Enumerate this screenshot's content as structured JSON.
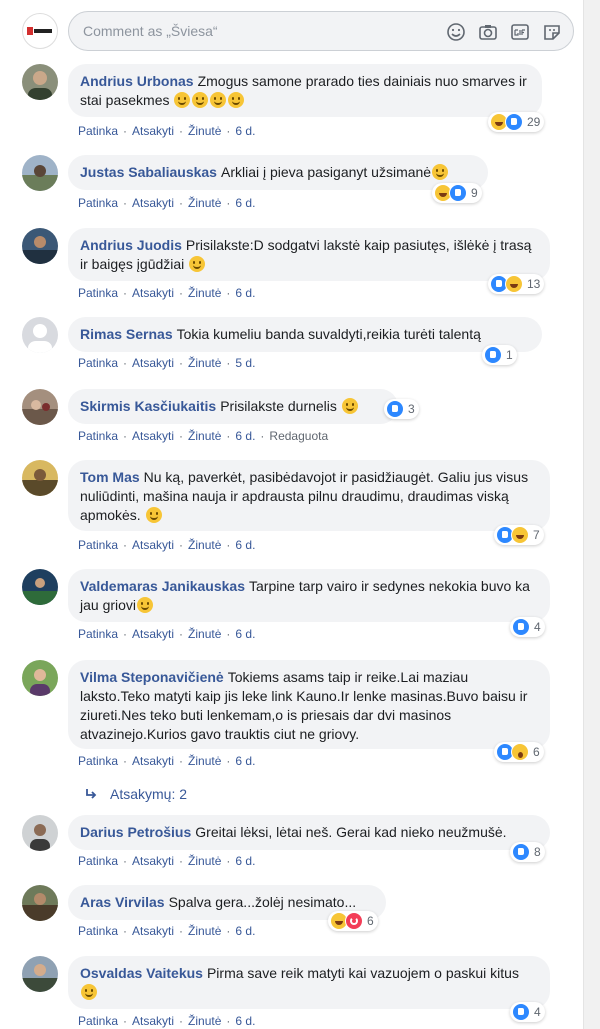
{
  "composer": {
    "placeholder": "Comment as „Šviesa“"
  },
  "comments": [
    {
      "author": "Andrius Urbonas",
      "text": "Zmogus samone prarado ties dainiais nuo smarves ir stai pasekmes",
      "emoji_count": 4,
      "reactions": [
        "haha",
        "like"
      ],
      "count": "29",
      "like": "Patinka",
      "reply": "Atsakyti",
      "see": "Žinutė",
      "time": "6 d."
    },
    {
      "author": "Justas Sabaliauskas",
      "text": "Arkliai į pieva pasiganyt užsimanė",
      "emoji_count": 1,
      "reactions": [
        "haha",
        "like"
      ],
      "count": "9",
      "like": "Patinka",
      "reply": "Atsakyti",
      "see": "Žinutė",
      "time": "6 d."
    },
    {
      "author": "Andrius Juodis",
      "text": "Prisilakste:D sodgatvi lakstė kaip pasiutęs, išlėkė į trasą ir baigęs įgūdžiai",
      "emoji_count": 1,
      "reactions": [
        "like",
        "haha"
      ],
      "count": "13",
      "like": "Patinka",
      "reply": "Atsakyti",
      "see": "Žinutė",
      "time": "6 d."
    },
    {
      "author": "Rimas Sernas",
      "text": "Tokia kumeliu banda suvaldyti,reikia turėti talentą",
      "emoji_count": 0,
      "reactions": [
        "like"
      ],
      "count": "1",
      "like": "Patinka",
      "reply": "Atsakyti",
      "see": "Žinutė",
      "time": "5 d."
    },
    {
      "author": "Skirmis Kasčiukaitis",
      "text": "Prisilakste durnelis",
      "emoji_count": 1,
      "reactions": [
        "like"
      ],
      "count": "3",
      "like": "Patinka",
      "reply": "Atsakyti",
      "see": "Žinutė",
      "time": "6 d.",
      "edited": "Redaguota"
    },
    {
      "author": "Tom Mas",
      "text": "Nu ką, paverkėt, pasibėdavojot ir pasidžiaugėt. Galiu jus visus nuliūdinti, mašina nauja ir apdrausta pilnu draudimu, draudimas viską apmokės.",
      "emoji_count": 1,
      "reactions": [
        "like",
        "haha"
      ],
      "count": "7",
      "like": "Patinka",
      "reply": "Atsakyti",
      "see": "Žinutė",
      "time": "6 d."
    },
    {
      "author": "Valdemaras Janikauskas",
      "text": "Tarpine tarp vairo ir sedynes nekokia buvo ka jau griovi",
      "emoji_count": 1,
      "reactions": [
        "like"
      ],
      "count": "4",
      "like": "Patinka",
      "reply": "Atsakyti",
      "see": "Žinutė",
      "time": "6 d."
    },
    {
      "author": "Vilma Steponavičienė",
      "text": "Tokiems asams taip ir reike.Lai maziau laksto.Teko matyti kaip jis leke link Kauno.Ir lenke masinas.Buvo baisu ir ziureti.Nes teko buti lenkemam,o is priesais dar dvi masinos atvazinejo.Kurios gavo trauktis ciut ne griovy.",
      "emoji_count": 0,
      "reactions": [
        "like",
        "wow"
      ],
      "count": "6",
      "like": "Patinka",
      "reply": "Atsakyti",
      "see": "Žinutė",
      "time": "6 d."
    },
    {
      "author": "Darius Petrošius",
      "text": "Greitai lėksi, lėtai neš. Gerai kad nieko neužmušė.",
      "emoji_count": 0,
      "reactions": [
        "like"
      ],
      "count": "8",
      "like": "Patinka",
      "reply": "Atsakyti",
      "see": "Žinutė",
      "time": "6 d."
    },
    {
      "author": "Aras Virvilas",
      "text": "Spalva gera...žolėj nesimato...",
      "emoji_count": 0,
      "reactions": [
        "haha",
        "love"
      ],
      "count": "6",
      "like": "Patinka",
      "reply": "Atsakyti",
      "see": "Žinutė",
      "time": "6 d."
    },
    {
      "author": "Osvaldas Vaitekus",
      "text": "Pirma save reik matyti kai vazuojem o paskui kitus",
      "emoji_count": 1,
      "reactions": [
        "like"
      ],
      "count": "4",
      "like": "Patinka",
      "reply": "Atsakyti",
      "see": "Žinutė",
      "time": "6 d."
    }
  ],
  "replies_link": "Atsakymų: 2",
  "colors": {
    "link": "#385898",
    "bubble": "#f2f3f5",
    "meta": "#606770",
    "like": "#2d88ff"
  },
  "icons": {
    "composer": [
      "smiley-icon",
      "camera-icon",
      "gif-icon",
      "sticker-icon"
    ],
    "reply": "reply-arrow-icon"
  }
}
